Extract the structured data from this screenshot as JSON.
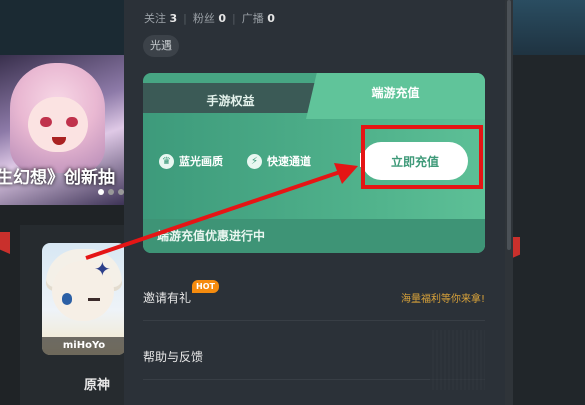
{
  "profile": {
    "following_label": "关注",
    "following_count": "3",
    "fans_label": "粉丝",
    "fans_count": "0",
    "broadcast_label": "广播",
    "broadcast_count": "0",
    "tag": "光遇"
  },
  "recharge_card": {
    "tab_mobile": "手游权益",
    "tab_pc": "端游充值",
    "feature_1": "蓝光画质",
    "feature_2": "快速通道",
    "recharge_button": "立即充值",
    "promo_text": "端游充值优惠进行中"
  },
  "menu": {
    "invite_label": "邀请有礼",
    "invite_badge": "HOT",
    "invite_note": "海量福利等你来拿!",
    "help_label": "帮助与反馈"
  },
  "banner": {
    "caption": "生幻想》创新抽"
  },
  "game": {
    "name": "原神",
    "publisher_logo": "miHoYo"
  },
  "colors": {
    "accent_green": "#47a583",
    "highlight_red": "#e51515",
    "hot_orange": "#f58b0e"
  },
  "icons": {
    "feature_1": "crown-icon",
    "feature_2": "lightning-icon"
  }
}
